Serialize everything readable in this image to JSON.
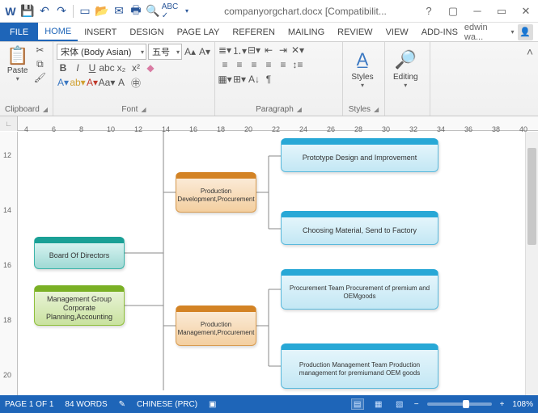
{
  "title": "companyorgchart.docx [Compatibilit...",
  "file_tab": "FILE",
  "tabs": [
    "HOME",
    "INSERT",
    "DESIGN",
    "PAGE LAY",
    "REFEREN",
    "MAILING",
    "REVIEW",
    "VIEW",
    "ADD-INS"
  ],
  "user": "edwin wa...",
  "ribbon": {
    "clipboard": {
      "paste": "Paste",
      "label": "Clipboard"
    },
    "font": {
      "family": "宋体 (Body Asian)",
      "size": "五号",
      "label": "Font"
    },
    "paragraph": {
      "label": "Paragraph"
    },
    "styles": {
      "btn": "Styles",
      "label": "Styles"
    },
    "editing": {
      "btn": "Editing",
      "label": ""
    }
  },
  "ruler_h": [
    "4",
    "6",
    "8",
    "10",
    "12",
    "14",
    "16",
    "18",
    "20",
    "22",
    "24",
    "26",
    "28",
    "30",
    "32",
    "34",
    "36",
    "38",
    "40"
  ],
  "ruler_v": [
    "12",
    "14",
    "16",
    "18",
    "20"
  ],
  "org": {
    "board": "Board Of Directors",
    "mgmt": "Management Group Corporate Planning,Accounting",
    "dev": "Production Development,Procurement",
    "mgmtproc": "Production Management,Procurement",
    "proto": "Prototype Design and Improvement",
    "material": "Choosing Material, Send to Factory",
    "procteam": "Procurement Team Procurement of premium and OEMgoods",
    "prodteam": "Production Management Team Production management for premiumand OEM goods"
  },
  "status": {
    "page": "PAGE 1 OF 1",
    "words": "84 WORDS",
    "lang": "CHINESE (PRC)",
    "zoom": "108%"
  }
}
